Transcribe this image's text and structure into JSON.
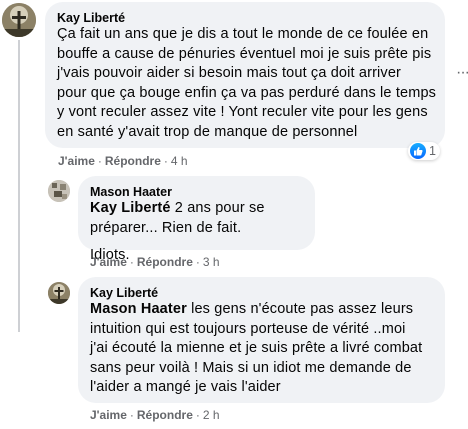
{
  "comments": [
    {
      "author": "Kay Liberté",
      "lines": [
        "Ça fait un ans que je dis a tout le monde de ce foulée en",
        "bouffe a cause de pénuries éventuel moi je suis prête pis",
        "j'vais pouvoir aider si besoin mais tout ça doit arriver",
        "pour que ça bouge enfin ça va pas perduré dans le temps",
        "y vont reculer assez vite ! Yont reculer vite pour les gens",
        "en santé y'avait trop de manque de personnel"
      ],
      "like_label": "J'aime",
      "reply_label": "Répondre",
      "time": "4 h",
      "reaction_count": "1"
    },
    {
      "author": "Mason Haater",
      "mention": "Kay Liberté",
      "line1_rest": " 2 ans pour se préparer... Rien de fait.",
      "line2": "Idiots.",
      "like_label": "J'aime",
      "reply_label": "Répondre",
      "time": "3 h"
    },
    {
      "author": "Kay Liberté",
      "mention": "Mason Haater",
      "line1_rest": " les gens n'écoute pas assez leurs",
      "lines": [
        "intuition qui est toujours porteuse de vérité ..moi",
        "j'ai écouté la mienne et je suis prête a livré combat",
        "sans peur voilà ! Mais si un idiot me demande de",
        "l'aider a mangé je vais l'aider"
      ],
      "like_label": "J'aime",
      "reply_label": "Répondre",
      "time": "2 h"
    }
  ],
  "icons": {
    "more": "more-options-icon",
    "like": "like-icon"
  },
  "colors": {
    "bubble": "#f0f2f5",
    "meta": "#65676b",
    "like_blue": "#0866ff"
  }
}
